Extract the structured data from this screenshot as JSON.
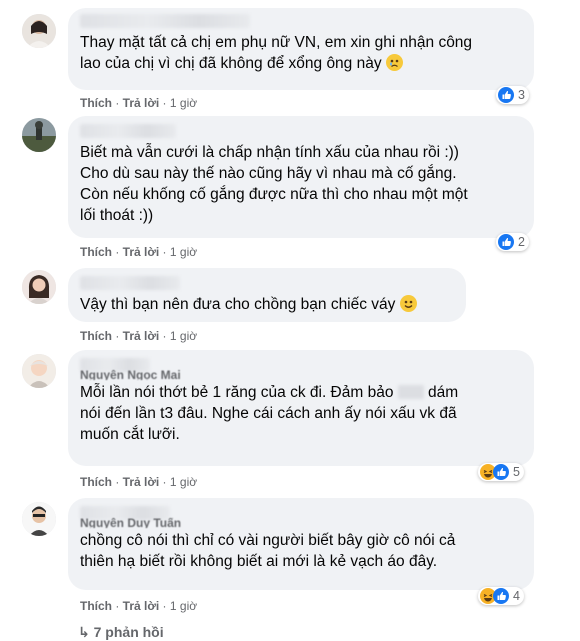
{
  "comments": [
    {
      "author_partial": "",
      "text": "Thay mặt tất cả chị em phụ nữ VN, em xin ghi nhận công\nlao của chị vì chị đã không để xổng ông này",
      "like": "Thích",
      "reply": "Trả lời",
      "time": "1 giờ",
      "reaction_count": "3",
      "reaction_icons": [
        "like-reaction-icon"
      ]
    },
    {
      "author_partial": "",
      "text": "Biết mà vẫn cưới là chấp nhận tính xấu của nhau rồi :))\nCho dù sau này thế nào cũng hãy vì nhau mà cố gắng.\nCòn nếu khống cố gắng được nữa thì cho nhau một một\nlối thoát :))",
      "like": "Thích",
      "reply": "Trả lời",
      "time": "1 giờ",
      "reaction_count": "2",
      "reaction_icons": [
        "like-reaction-icon"
      ]
    },
    {
      "author_partial": "",
      "text": "Vậy thì bạn nên đưa cho chồng bạn chiếc váy",
      "like": "Thích",
      "reply": "Trả lời",
      "time": "1 giờ",
      "reaction_count": "",
      "reaction_icons": []
    },
    {
      "author_partial": "Nguyễn Ngọc Mai",
      "text_before": "Mỗi lần nói thớt bẻ 1 răng của ck đi. Đảm bảo ",
      "text_after": " dám\nnói đến lần t3 đâu. Nghe cái cách anh ấy nói xấu vk đã\nmuốn cắt lưỡi.",
      "like": "Thích",
      "reply": "Trả lời",
      "time": "1 giờ",
      "reaction_count": "5",
      "reaction_icons": [
        "haha-reaction-icon",
        "like-reaction-icon"
      ]
    },
    {
      "author_partial": "Nguyễn Duy Tuấn",
      "text": "chồng cô nói thì chỉ có vài người biết bây giờ cô nói cả\nthiên hạ biết rồi không biết ai mới là kẻ vạch áo đây.",
      "like": "Thích",
      "reply": "Trả lời",
      "time": "1 giờ",
      "reaction_count": "4",
      "reaction_icons": [
        "haha-reaction-icon",
        "like-reaction-icon"
      ]
    }
  ],
  "more_replies": "7 phản hồi",
  "colors": {
    "bubble": "#f0f2f5",
    "meta_text": "#65676b",
    "like_blue": "#1877f2",
    "haha_yellow": "#f7b125"
  }
}
